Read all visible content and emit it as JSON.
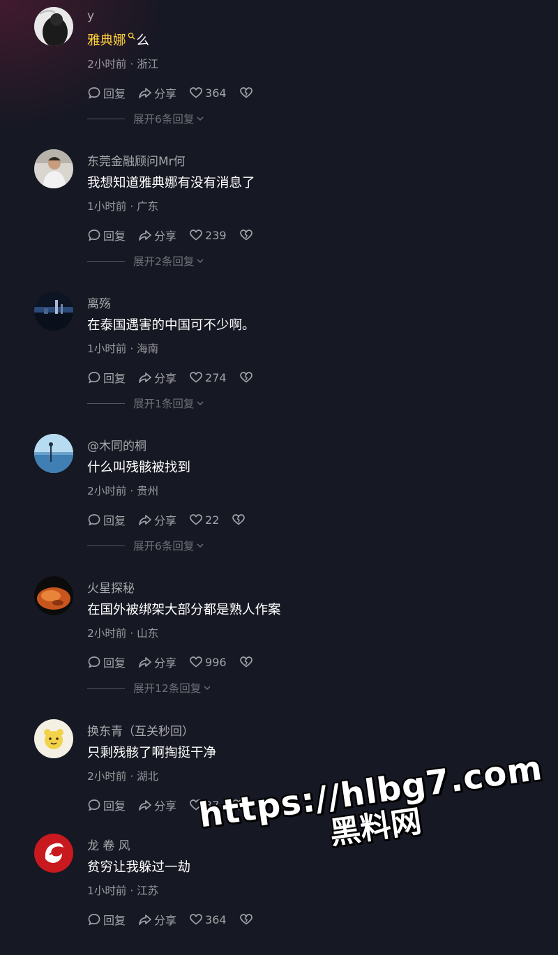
{
  "comments": [
    {
      "username": "y",
      "content_link": "雅典娜",
      "content": "么",
      "time": "2小时前",
      "location": "浙江",
      "reply_label": "回复",
      "share_label": "分享",
      "likes": "364",
      "expand_label": "展开6条回复",
      "avatar_icon": "dark-figure-avatar"
    },
    {
      "username": "东莞金融顾问Mr何",
      "content": "我想知道雅典娜有没有消息了",
      "time": "1小时前",
      "location": "广东",
      "reply_label": "回复",
      "share_label": "分享",
      "likes": "239",
      "expand_label": "展开2条回复",
      "avatar_icon": "man-portrait-avatar"
    },
    {
      "username": "离殇",
      "content": "在泰国遇害的中国可不少啊。",
      "time": "1小时前",
      "location": "海南",
      "reply_label": "回复",
      "share_label": "分享",
      "likes": "274",
      "expand_label": "展开1条回复",
      "avatar_icon": "night-skyline-avatar"
    },
    {
      "username": "@木同的桐",
      "content": "什么叫残骸被找到",
      "time": "2小时前",
      "location": "贵州",
      "reply_label": "回复",
      "share_label": "分享",
      "likes": "22",
      "expand_label": "展开6条回复",
      "avatar_icon": "lake-scenery-avatar"
    },
    {
      "username": "火星探秘",
      "content": "在国外被绑架大部分都是熟人作案",
      "time": "2小时前",
      "location": "山东",
      "reply_label": "回复",
      "share_label": "分享",
      "likes": "996",
      "expand_label": "展开12条回复",
      "avatar_icon": "orange-planet-avatar"
    },
    {
      "username": "换东青（互关秒回）",
      "content": "只剩残骸了啊掏挺干净",
      "time": "2小时前",
      "location": "湖北",
      "reply_label": "回复",
      "share_label": "分享",
      "likes": "37",
      "expand_label": "",
      "avatar_icon": "yellow-cartoon-avatar"
    },
    {
      "username": "龙 卷 风",
      "content": "贫穷让我躲过一劫",
      "time": "1小时前",
      "location": "江苏",
      "reply_label": "回复",
      "share_label": "分享",
      "likes": "364",
      "expand_label": "",
      "avatar_icon": "red-logo-avatar"
    }
  ],
  "watermark": {
    "url": "https://hlbg7.com",
    "name": "黑料网"
  },
  "colors": {
    "background": "#161823",
    "link": "#ffd13a"
  }
}
